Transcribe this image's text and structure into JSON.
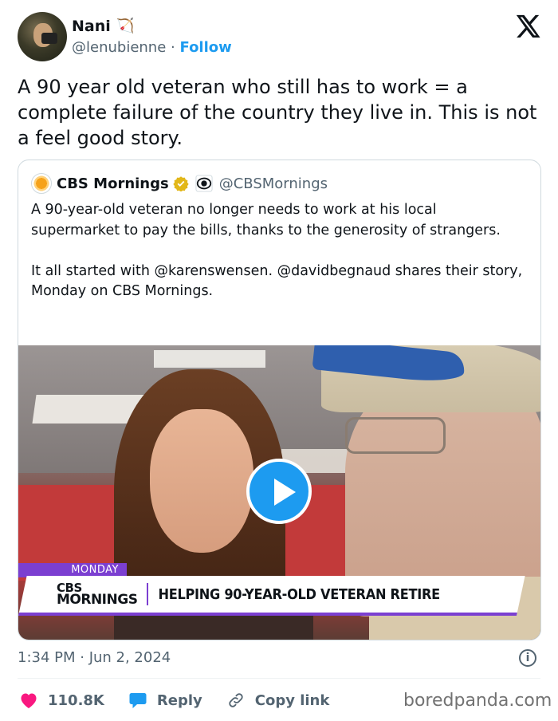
{
  "author": {
    "name": "Nani",
    "emoji": "🏹",
    "handle": "@lenubienne",
    "separator": "·",
    "follow_label": "Follow"
  },
  "tweet": {
    "text": "A 90 year old veteran who still has to work = a complete failure of the country they live in. This is not a feel good story.",
    "timestamp": "1:34 PM · Jun 2, 2024"
  },
  "quoted": {
    "name": "CBS Mornings",
    "handle": "@CBSMornings",
    "text": "A 90-year-old veteran no longer needs to work at his local supermarket to pay the bills, thanks to the generosity of strangers.\n\nIt all started with @karenswensen. @davidbegnaud shares their story, Monday on CBS Mornings.",
    "video": {
      "day_tag": "MONDAY",
      "brand_line1": "CBS",
      "brand_line2": "MORNINGS",
      "headline": "HELPING 90-YEAR-OLD VETERAN RETIRE"
    }
  },
  "actions": {
    "likes": "110.8K",
    "reply_label": "Reply",
    "copy_label": "Copy link"
  },
  "watermark": "boredpanda.com",
  "colors": {
    "accent": "#1d9bf0",
    "like": "#f91880",
    "muted": "#536471",
    "cbs_purple": "#7b3fd1"
  },
  "icons": [
    "x-logo-icon",
    "verified-badge-icon",
    "cbs-eye-icon",
    "play-icon",
    "info-icon",
    "heart-icon",
    "reply-bubble-icon",
    "link-icon"
  ]
}
